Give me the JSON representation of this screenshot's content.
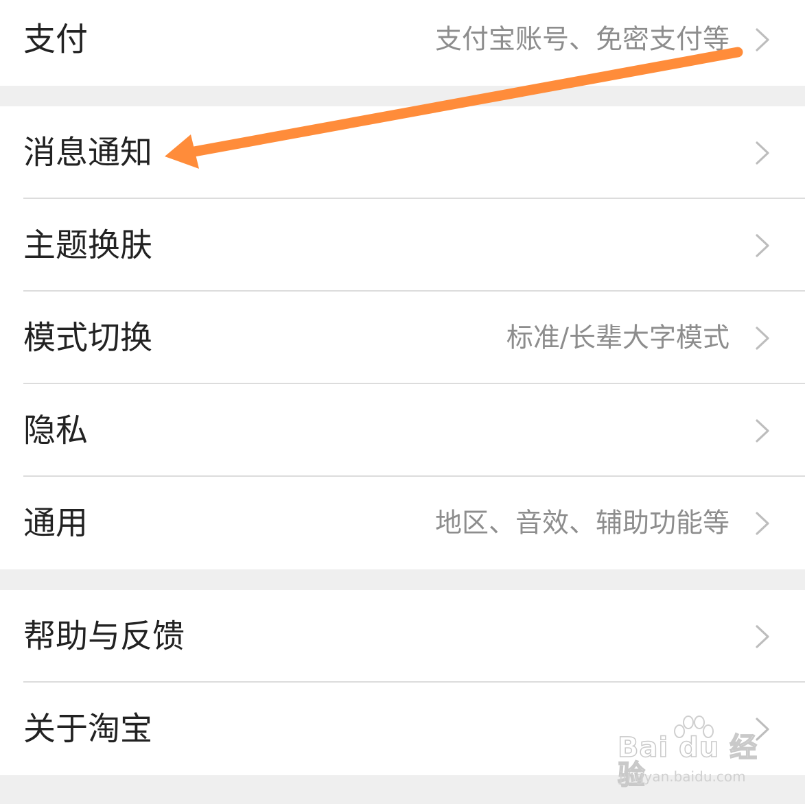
{
  "settings": {
    "rows": [
      {
        "label": "支付",
        "value": "支付宝账号、免密支付等"
      },
      {
        "label": "消息通知",
        "value": ""
      },
      {
        "label": "主题换肤",
        "value": ""
      },
      {
        "label": "模式切换",
        "value": "标准/长辈大字模式"
      },
      {
        "label": "隐私",
        "value": ""
      },
      {
        "label": "通用",
        "value": "地区、音效、辅助功能等"
      },
      {
        "label": "帮助与反馈",
        "value": ""
      },
      {
        "label": "关于淘宝",
        "value": ""
      }
    ]
  },
  "annotation": {
    "arrow_color": "#ff8c3a",
    "icon": "arrow-left-icon"
  },
  "watermark": {
    "logo": "Bai du 经验",
    "url": "jingyan.baidu.com"
  },
  "colors": {
    "background": "#efefef",
    "row": "#ffffff",
    "label": "#222222",
    "value": "#8d8d8d",
    "chevron": "#bdbdbd",
    "divider": "#dcdcdc"
  }
}
